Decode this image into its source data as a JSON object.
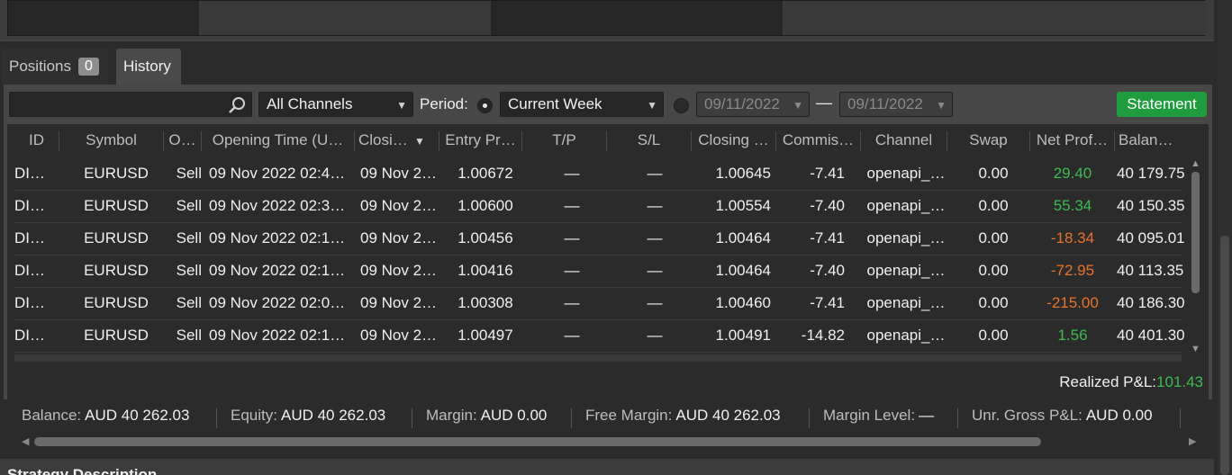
{
  "tabs": {
    "positions_label": "Positions",
    "positions_count": "0",
    "history_label": "History"
  },
  "toolbar": {
    "search_placeholder": "",
    "channels_value": "All Channels",
    "period_label": "Period:",
    "period_value": "Current Week",
    "date_from": "09/11/2022",
    "date_to": "09/11/2022",
    "date_separator": "—",
    "statement_label": "Statement"
  },
  "table": {
    "headers": [
      "ID",
      "Symbol",
      "O…",
      "Opening Time (U…",
      "Closi…",
      "Entry Pr…",
      "T/P",
      "S/L",
      "Closing …",
      "Commis…",
      "Channel",
      "Swap",
      "Net Prof…",
      "Balan…"
    ],
    "rows": [
      {
        "id": "DI…",
        "symbol": "EURUSD",
        "side": "Sell",
        "open_time": "09 Nov 2022 02:4…",
        "close_time": "09 Nov 2…",
        "entry": "1.00672",
        "tp": "—",
        "sl": "—",
        "closing": "1.00645",
        "commission": "-7.41",
        "channel": "openapi_…",
        "swap": "0.00",
        "net_profit": "29.40",
        "balance": "40 179.75"
      },
      {
        "id": "DI…",
        "symbol": "EURUSD",
        "side": "Sell",
        "open_time": "09 Nov 2022 02:3…",
        "close_time": "09 Nov 2…",
        "entry": "1.00600",
        "tp": "—",
        "sl": "—",
        "closing": "1.00554",
        "commission": "-7.40",
        "channel": "openapi_…",
        "swap": "0.00",
        "net_profit": "55.34",
        "balance": "40 150.35"
      },
      {
        "id": "DI…",
        "symbol": "EURUSD",
        "side": "Sell",
        "open_time": "09 Nov 2022 02:1…",
        "close_time": "09 Nov 2…",
        "entry": "1.00456",
        "tp": "—",
        "sl": "—",
        "closing": "1.00464",
        "commission": "-7.41",
        "channel": "openapi_…",
        "swap": "0.00",
        "net_profit": "-18.34",
        "balance": "40 095.01"
      },
      {
        "id": "DI…",
        "symbol": "EURUSD",
        "side": "Sell",
        "open_time": "09 Nov 2022 02:1…",
        "close_time": "09 Nov 2…",
        "entry": "1.00416",
        "tp": "—",
        "sl": "—",
        "closing": "1.00464",
        "commission": "-7.40",
        "channel": "openapi_…",
        "swap": "0.00",
        "net_profit": "-72.95",
        "balance": "40 113.35"
      },
      {
        "id": "DI…",
        "symbol": "EURUSD",
        "side": "Sell",
        "open_time": "09 Nov 2022 02:0…",
        "close_time": "09 Nov 2…",
        "entry": "1.00308",
        "tp": "—",
        "sl": "—",
        "closing": "1.00460",
        "commission": "-7.41",
        "channel": "openapi_…",
        "swap": "0.00",
        "net_profit": "-215.00",
        "balance": "40 186.30"
      },
      {
        "id": "DI…",
        "symbol": "EURUSD",
        "side": "Sell",
        "open_time": "09 Nov 2022 02:1…",
        "close_time": "09 Nov 2…",
        "entry": "1.00497",
        "tp": "—",
        "sl": "—",
        "closing": "1.00491",
        "commission": "-14.82",
        "channel": "openapi_…",
        "swap": "0.00",
        "net_profit": "1.56",
        "balance": "40 401.30"
      }
    ]
  },
  "realized": {
    "label": "Realized P&L:",
    "value": "101.43"
  },
  "summary": {
    "balance_label": "Balance:",
    "balance_value": "AUD 40 262.03",
    "equity_label": "Equity:",
    "equity_value": "AUD 40 262.03",
    "margin_label": "Margin:",
    "margin_value": "AUD 0.00",
    "free_margin_label": "Free Margin:",
    "free_margin_value": "AUD 40 262.03",
    "margin_level_label": "Margin Level:",
    "margin_level_value": "—",
    "unr_label": "Unr. Gross P&L:",
    "unr_value": "AUD 0.00"
  },
  "bottom": {
    "title": "Strategy Description"
  },
  "colors": {
    "positive": "#3dbb4f",
    "negative": "#e8732a",
    "statement_button": "#1f9d3e"
  }
}
